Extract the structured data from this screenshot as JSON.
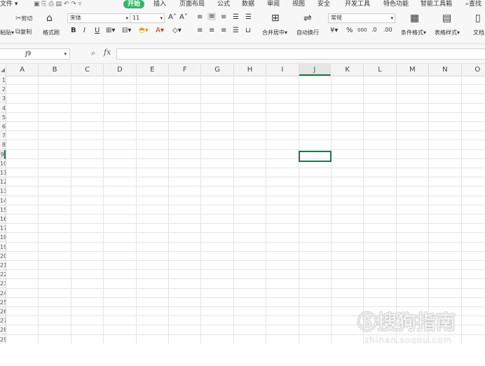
{
  "menu": {
    "file": "文件",
    "tabs": [
      "开始",
      "插入",
      "页面布局",
      "公式",
      "数据",
      "审阅",
      "视图",
      "安全",
      "开发工具",
      "特色功能",
      "智能工具箱"
    ],
    "search_label": "查找"
  },
  "ribbon": {
    "paste_label": "粘贴",
    "cut_label": "剪切",
    "copy_label": "复制",
    "format_painter_label": "格式刷",
    "font_name": "宋体",
    "font_size": "11",
    "bold": "B",
    "italic": "I",
    "underline": "U",
    "merge_label": "合并居中",
    "wrap_label": "自动换行",
    "number_format": "常规",
    "percent": "%",
    "thousands": "000",
    "conditional_format_label": "条件格式",
    "table_style_label": "表格样式",
    "text_label": "文档"
  },
  "formula_bar": {
    "name_box": "J9",
    "fx": "fx",
    "value": ""
  },
  "columns": [
    "A",
    "B",
    "C",
    "D",
    "E",
    "F",
    "G",
    "H",
    "I",
    "J",
    "K",
    "L",
    "M",
    "N",
    "O"
  ],
  "selected_column": "J",
  "rows": [
    "1",
    "2",
    "3",
    "4",
    "5",
    "6",
    "7",
    "8",
    "9",
    "10",
    "11",
    "12",
    "13",
    "14",
    "15",
    "16",
    "17",
    "18",
    "19",
    "20",
    "21",
    "22",
    "23",
    "24",
    "25",
    "26",
    "27",
    "28",
    "29"
  ],
  "selected_cell": "J9",
  "watermark": {
    "main": "搜狗指南",
    "sub": "zhinan.sogou.com"
  },
  "colors": {
    "accent": "#2fb56a",
    "selection": "#217346"
  }
}
